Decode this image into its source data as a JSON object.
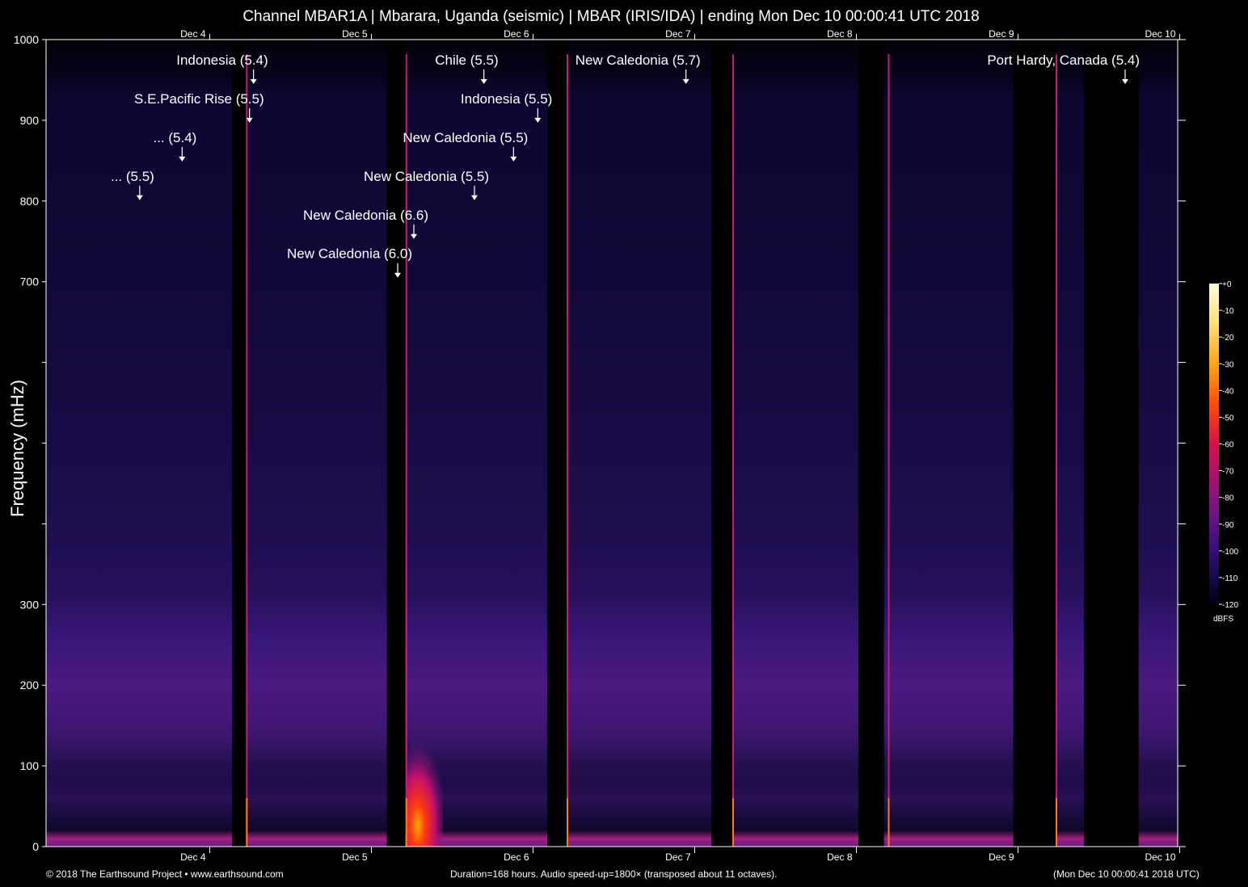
{
  "title": "Channel MBAR1A | Mbarara, Uganda (seismic) | MBAR (IRIS/IDA) | ending Mon Dec 10 00:00:41 UTC 2018",
  "footer": {
    "left": "© 2018 The Earthsound Project • www.earthsound.com",
    "center": "Duration=168 hours. Audio speed-up=1800× (transposed about 11 octaves).",
    "right": "(Mon Dec 10 00:00:41 2018 UTC)"
  },
  "colors": {
    "background": "#000000",
    "spectrum_low": "#0a0630",
    "spectrum_mid": "#40157a",
    "spectrum_high": "#ffd24a"
  },
  "chart_data": {
    "type": "heatmap",
    "title": "Channel MBAR1A | Mbarara, Uganda (seismic) | MBAR (IRIS/IDA) | ending Mon Dec 10 00:00:41 UTC 2018",
    "ylabel": "Frequency (mHz)",
    "xlabel": "",
    "x_range_hours": [
      0,
      168
    ],
    "ylim": [
      0,
      1000
    ],
    "y_ticks": [
      {
        "value": 0,
        "label": "0"
      },
      {
        "value": 100,
        "label": "100"
      },
      {
        "value": 200,
        "label": "200"
      },
      {
        "value": 300,
        "label": "300"
      },
      {
        "value": 400,
        "label": ""
      },
      {
        "value": 500,
        "label": ""
      },
      {
        "value": 600,
        "label": ""
      },
      {
        "value": 700,
        "label": "700"
      },
      {
        "value": 800,
        "label": "800"
      },
      {
        "value": 900,
        "label": "900"
      },
      {
        "value": 1000,
        "label": "1000"
      }
    ],
    "x_ticks": [
      {
        "hour": 24.3,
        "label": "Dec 4"
      },
      {
        "hour": 48.3,
        "label": "Dec 5"
      },
      {
        "hour": 72.3,
        "label": "Dec 6"
      },
      {
        "hour": 96.3,
        "label": "Dec 7"
      },
      {
        "hour": 120.3,
        "label": "Dec 8"
      },
      {
        "hour": 144.3,
        "label": "Dec 9"
      },
      {
        "hour": 168.3,
        "label": "Dec 10"
      }
    ],
    "gaps_hours": [
      [
        27.6,
        29.8
      ],
      [
        50.6,
        53.3
      ],
      [
        74.4,
        77.5
      ],
      [
        98.8,
        102.0
      ],
      [
        120.6,
        124.4
      ],
      [
        143.6,
        150.1
      ],
      [
        154.1,
        162.2
      ]
    ],
    "impulses_hours": [
      29.8,
      53.5,
      77.4,
      102.0,
      125.1,
      150.0
    ],
    "bright_event": {
      "hour": 54.5,
      "max_freq": 130
    },
    "colorbar": {
      "unit": "dBFS",
      "min": -120,
      "max": 0,
      "ticks": [
        "+0",
        "-10",
        "-20",
        "-30",
        "-40",
        "-50",
        "-60",
        "-70",
        "-80",
        "-90",
        "-100",
        "-110",
        "-120"
      ]
    },
    "annotations": [
      {
        "label": "Indonesia (5.4)",
        "hour": 30.8,
        "freq": 950
      },
      {
        "label": "S.E.Pacific Rise (5.5)",
        "hour": 30.2,
        "freq": 902
      },
      {
        "label": "... (5.4)",
        "hour": 20.2,
        "freq": 854
      },
      {
        "label": "... (5.5)",
        "hour": 13.9,
        "freq": 806
      },
      {
        "label": "Chile (5.5)",
        "hour": 65.0,
        "freq": 950
      },
      {
        "label": "Indonesia (5.5)",
        "hour": 73.0,
        "freq": 902
      },
      {
        "label": "New Caledonia (5.5)",
        "hour": 69.4,
        "freq": 854
      },
      {
        "label": "New Caledonia (5.5)",
        "hour": 63.6,
        "freq": 806
      },
      {
        "label": "New Caledonia (6.6)",
        "hour": 54.6,
        "freq": 758
      },
      {
        "label": "New Caledonia (6.0)",
        "hour": 52.2,
        "freq": 710
      },
      {
        "label": "New Caledonia (5.7)",
        "hour": 95.0,
        "freq": 950
      },
      {
        "label": "Port Hardy, Canada (5.4)",
        "hour": 160.2,
        "freq": 950
      }
    ]
  }
}
